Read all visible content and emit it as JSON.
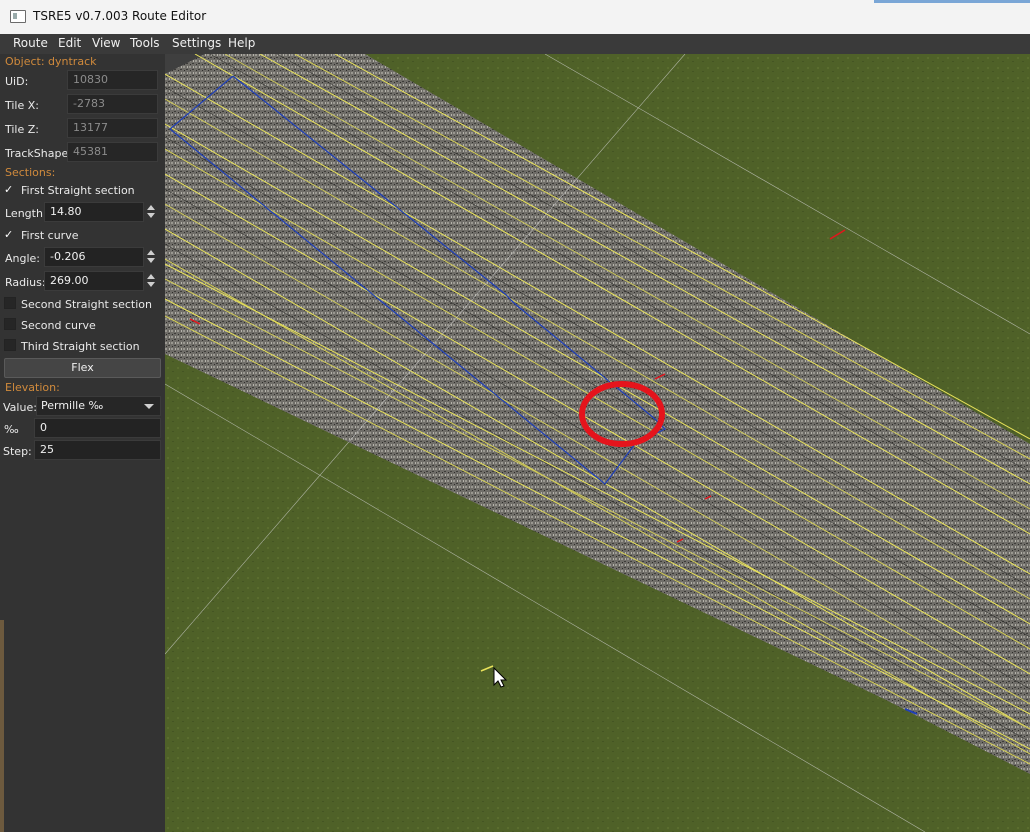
{
  "window": {
    "title": "TSRE5 v0.7.003 Route Editor"
  },
  "menu": [
    {
      "label": "Route"
    },
    {
      "label": "Edit"
    },
    {
      "label": "View"
    },
    {
      "label": "Tools"
    },
    {
      "label": "Settings"
    },
    {
      "label": "Help"
    }
  ],
  "panel": {
    "object_header": "Object: dyntrack",
    "uid": {
      "label": "UiD:",
      "value": "10830"
    },
    "tile_x": {
      "label": "Tile X:",
      "value": "-2783"
    },
    "tile_z": {
      "label": "Tile Z:",
      "value": "13177"
    },
    "trackshape": {
      "label": "TrackShape:",
      "value": "45381"
    },
    "sections_header": "Sections:",
    "first_straight": {
      "label": "First Straight section",
      "checked": true
    },
    "length": {
      "label": "Length:",
      "value": "14.80"
    },
    "first_curve": {
      "label": "First curve",
      "checked": true
    },
    "angle": {
      "label": "Angle:",
      "value": "-0.206"
    },
    "radius": {
      "label": "Radius:",
      "value": "269.00"
    },
    "second_straight": {
      "label": "Second Straight section",
      "checked": false
    },
    "second_curve": {
      "label": "Second curve",
      "checked": false
    },
    "third_straight": {
      "label": "Third Straight section",
      "checked": false
    },
    "flex_button": "Flex",
    "elevation_header": "Elevation:",
    "value_select": {
      "label": "Value:",
      "selected": "Permille ‰"
    },
    "permille": {
      "label": "‰",
      "value": "0"
    },
    "step": {
      "label": "Step:",
      "value": "25"
    }
  },
  "viewport": {
    "colors": {
      "grass": "#4f6128",
      "ballast": "#6f6d68",
      "rail": "#e8e25a",
      "selection": "#1f3fb8",
      "highlight": "#e5141c"
    }
  },
  "checkmark": "✓"
}
